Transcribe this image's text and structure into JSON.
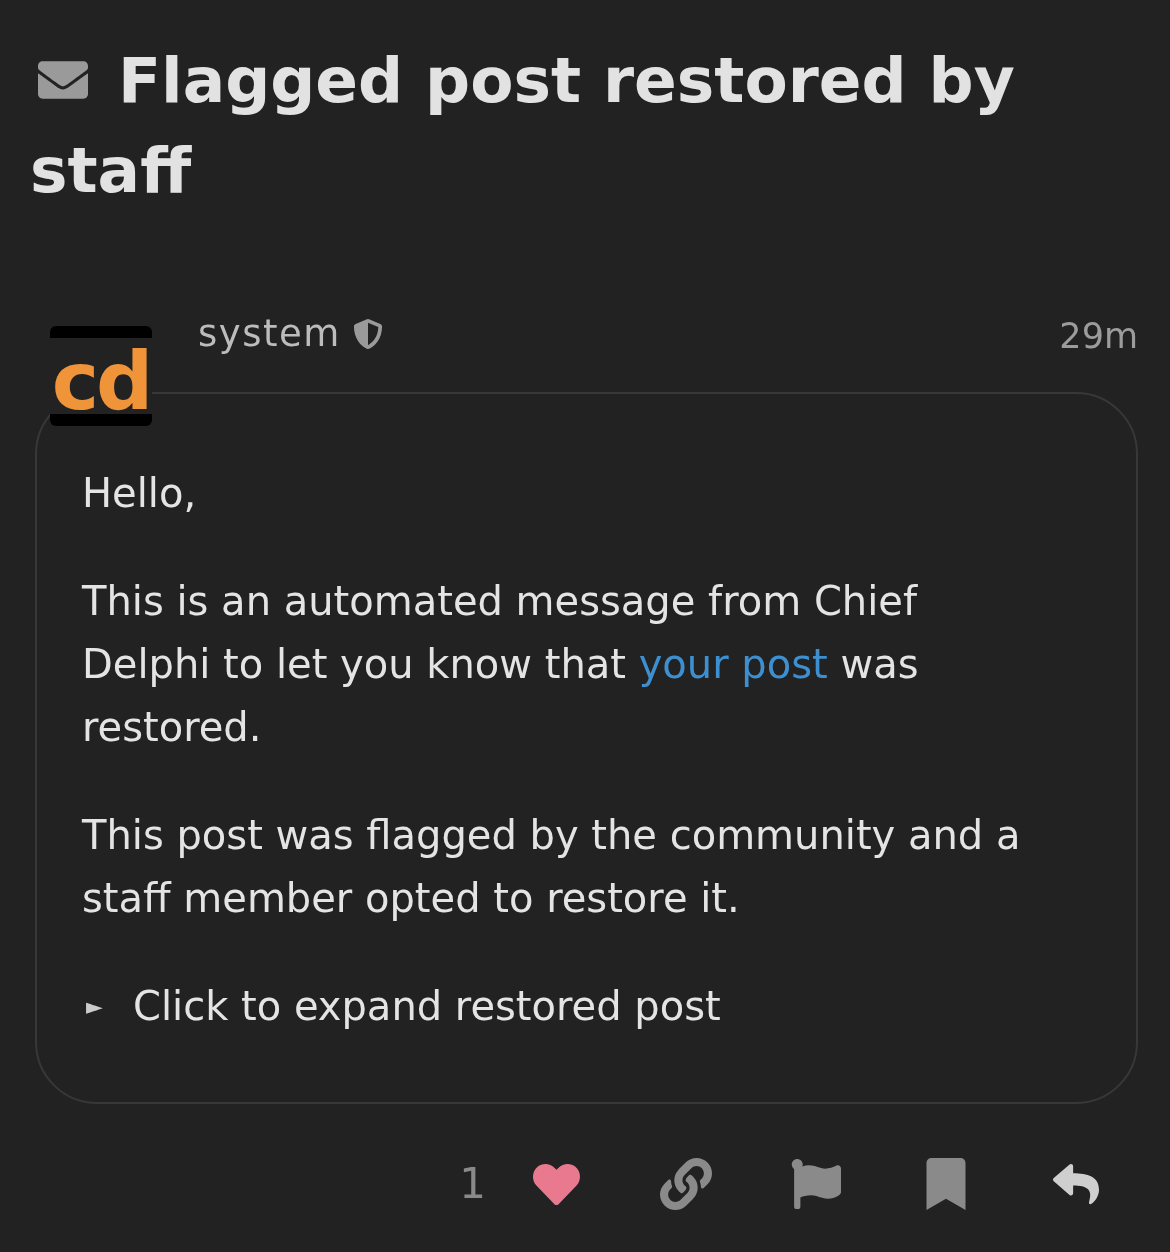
{
  "topic": {
    "private": true,
    "title": "Flagged post restored by staff"
  },
  "post": {
    "avatar": {
      "text": "cd"
    },
    "username": "system",
    "staff": true,
    "time": "29m",
    "paragraphs": [
      [
        {
          "text": "Hello,"
        }
      ],
      [
        {
          "text": "This is an automated message from Chief Delphi to let you know that "
        },
        {
          "text": "your post",
          "kind": "link"
        },
        {
          "text": " was restored."
        }
      ],
      [
        {
          "text": "This post was flagged by the community and a staff member opted to restore it."
        }
      ]
    ],
    "details": {
      "marker": "►",
      "summary": "Click to expand restored post",
      "expanded": false
    },
    "actions": [
      {
        "kind": "like",
        "count": "1",
        "liked": true
      },
      {
        "kind": "link"
      },
      {
        "kind": "flag"
      },
      {
        "kind": "bookmark",
        "bookmarked": false
      },
      {
        "kind": "reply"
      }
    ]
  }
}
